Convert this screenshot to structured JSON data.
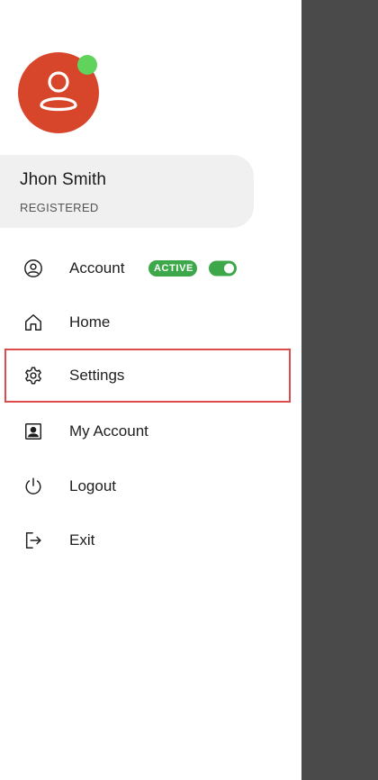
{
  "profile": {
    "name": "Jhon Smith",
    "status": "REGISTERED"
  },
  "colors": {
    "avatar": "#d7462a",
    "online": "#5fd35c",
    "accent_green": "#3da84a",
    "selection_border": "#dc4c4c",
    "scrim": "#4a4a4a"
  },
  "menu": {
    "items": [
      {
        "label": "Account",
        "icon": "account-circle-icon",
        "badge": "ACTIVE",
        "toggle_on": true
      },
      {
        "label": "Home",
        "icon": "home-icon"
      },
      {
        "label": "Settings",
        "icon": "gear-icon",
        "selected": true
      },
      {
        "label": "My Account",
        "icon": "contact-card-icon"
      },
      {
        "label": "Logout",
        "icon": "power-icon"
      },
      {
        "label": "Exit",
        "icon": "exit-icon"
      }
    ]
  }
}
